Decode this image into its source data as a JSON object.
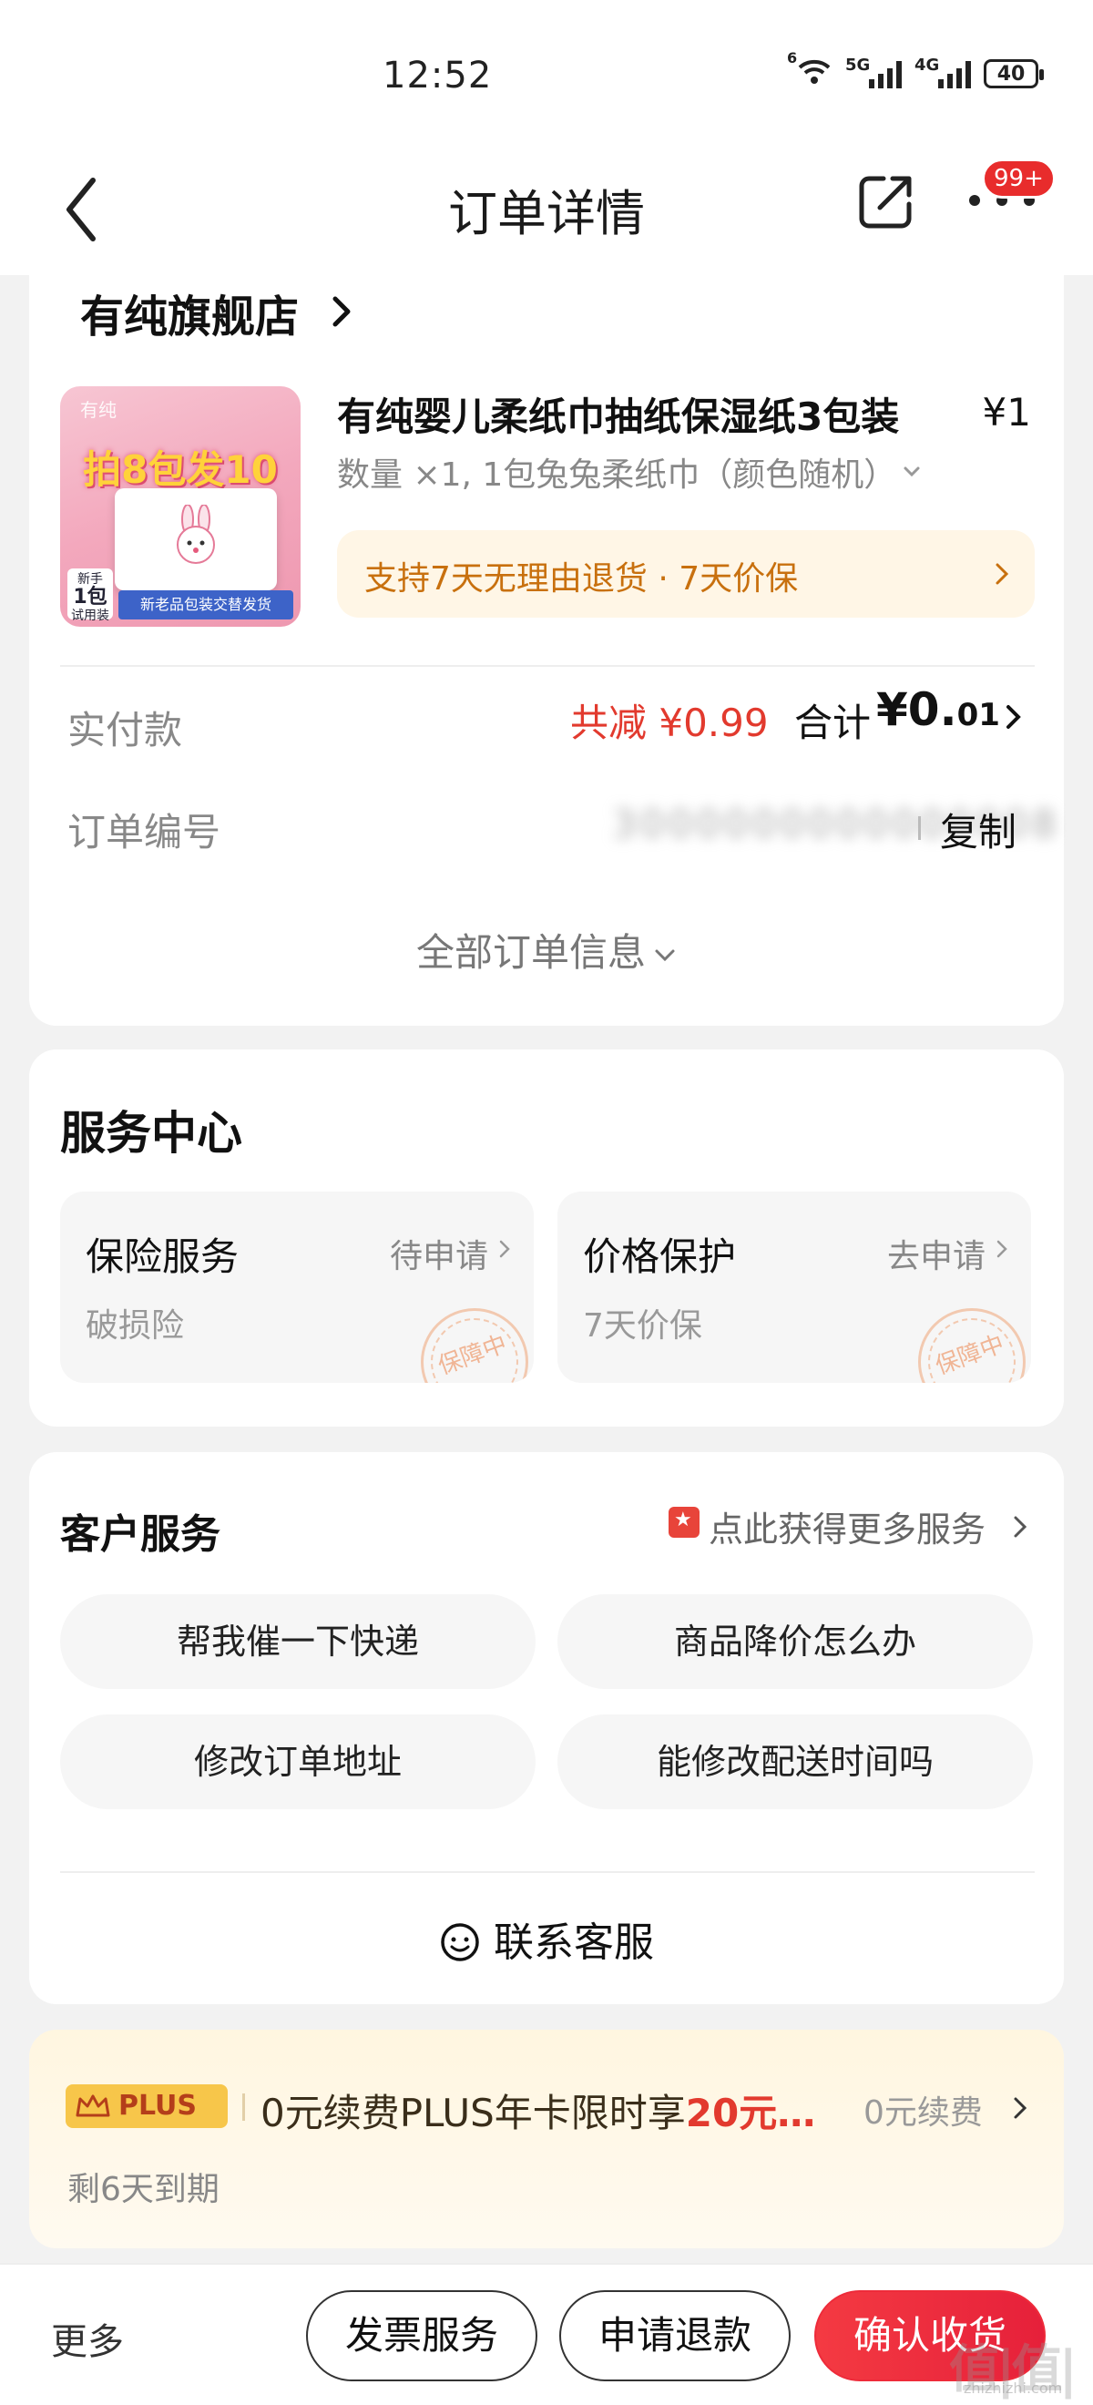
{
  "status_bar": {
    "time": "12:52",
    "wifi_label": "6",
    "signal1_label": "5G",
    "signal2_label": "4G",
    "battery": "40"
  },
  "nav": {
    "title": "订单详情",
    "badge": "99+"
  },
  "order": {
    "shop_name": "有纯旗舰店",
    "product": {
      "title": "有纯婴儿柔纸巾抽纸保湿纸3包装",
      "price": "¥1",
      "spec": "数量 ×1, 1包兔兔柔纸巾（颜色随机）",
      "image_brand": "有纯",
      "image_promo": "拍8包发10包",
      "image_tag_top": "新手",
      "image_tag_count": "1包",
      "image_tag_sub": "试用装",
      "image_band": "新老品包装交替发货"
    },
    "guarantee": "支持7天无理由退货 · 7天价保",
    "paid_label": "实付款",
    "discount": "共减 ¥0.99",
    "total_label": "合计",
    "total_value_main": "¥0.",
    "total_value_cents": "01",
    "order_no_label": "订单编号",
    "order_no_masked": "3000000000000008",
    "copy": "复制",
    "all_info": "全部订单信息"
  },
  "service_center": {
    "title": "服务中心",
    "items": [
      {
        "name": "保险服务",
        "action": "待申请",
        "sub": "破损险",
        "stamp": "保障中"
      },
      {
        "name": "价格保护",
        "action": "去申请",
        "sub": "7天价保",
        "stamp": "保障中"
      }
    ]
  },
  "customer_service": {
    "title": "客户服务",
    "more": "点此获得更多服务",
    "quick": [
      "帮我催一下快递",
      "商品降价怎么办",
      "修改订单地址",
      "能修改配送时间吗"
    ],
    "contact": "联系客服"
  },
  "plus": {
    "badge": "PLUS",
    "promo_pre": "0元续费PLUS年卡限时享",
    "promo_hl": "20元…",
    "action": "0元续费",
    "expiry": "剩6天到期"
  },
  "bottom_bar": {
    "more": "更多",
    "invoice": "发票服务",
    "refund": "申请退款",
    "confirm": "确认收货"
  },
  "watermark": {
    "main": "值|值|值",
    "sub": "zhizhizhi.com"
  },
  "colors": {
    "accent_red": "#e23a2e",
    "confirm_red": "#f43a42",
    "guarantee_orange": "#c8700e",
    "plus_gold": "#f7c64a"
  }
}
